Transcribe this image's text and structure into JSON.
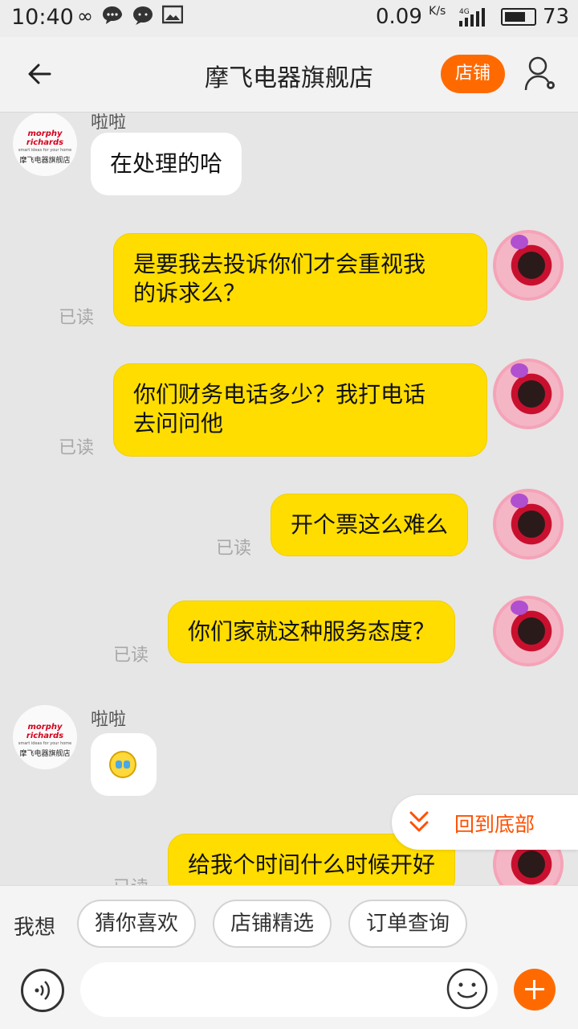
{
  "status_bar": {
    "time": "10:40",
    "speed": "0.09",
    "speed_unit": "K/s",
    "network": "4G",
    "battery": "73",
    "battery_fraction": 0.73,
    "icons": [
      "infinity-icon",
      "chat-bubble-icon",
      "message-icon",
      "image-icon"
    ]
  },
  "header": {
    "title": "摩飞电器旗舰店",
    "shop_button": "店铺",
    "accent_color": "#ff6a00"
  },
  "shop_avatar": {
    "brand": "morphy richards",
    "tagline": "smart ideas for your home",
    "name_cn": "摩飞电器旗舰店"
  },
  "messages": [
    {
      "side": "left",
      "sender": "啦啦",
      "text": "在处理的哈"
    },
    {
      "side": "right",
      "text_lines": [
        "是要我去投诉你们才会重视我",
        "的诉求么？"
      ],
      "read": "已读"
    },
    {
      "side": "right",
      "text_lines": [
        "你们财务电话多少？我打电话",
        "去问问他"
      ],
      "read": "已读"
    },
    {
      "side": "right",
      "text": "开个票这么难么",
      "read": "已读"
    },
    {
      "side": "right",
      "text": "你们家就这种服务态度？",
      "read": "已读"
    },
    {
      "side": "left",
      "sender": "啦啦",
      "emoji": "crying-face-emoji"
    },
    {
      "side": "right",
      "text": "给我个时间什么时候开好",
      "read": "已读"
    }
  ],
  "back_to_bottom": {
    "label": "回到底部"
  },
  "quick_bar": {
    "label": "我想",
    "chips": [
      "猜你喜欢",
      "店铺精选",
      "订单查询"
    ]
  },
  "input": {
    "value": "",
    "placeholder": ""
  }
}
